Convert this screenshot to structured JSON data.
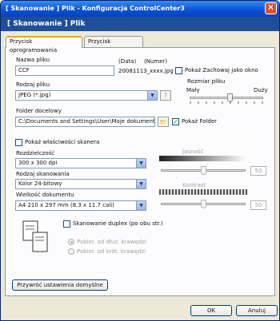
{
  "window": {
    "title": "[ Skanowanie ]  Plik - Konfiguracja ControlCenter3",
    "close_glyph": "×"
  },
  "header": {
    "text": "[ Skanowanie ]  Plik"
  },
  "tabs": [
    {
      "label": "Przycisk oprogramowania"
    },
    {
      "label": "Przycisk urządzenia"
    }
  ],
  "file_name": {
    "label": "Nazwa pliku",
    "value": "CCF",
    "date_label": "(Data)",
    "number_label": "(Numer)",
    "example": "20081113_xxxx.jpg"
  },
  "save_as_window": {
    "label": "Pokaż Zachowaj jako okno",
    "checked": false
  },
  "file_type": {
    "label": "Rodzaj pliku",
    "value": "JPEG (*.jpg)"
  },
  "file_size": {
    "label": "Rozmiar pliku",
    "small": "Mały",
    "large": "Duży",
    "level_fraction": 0.55
  },
  "dest_folder": {
    "label": "Folder docelowy",
    "value": "C:\\Documents and Settings\\User\\Moje dokumenty\\M",
    "show_folder_label": "Pokaż Folder",
    "show_folder_checked": true
  },
  "scanner_props": {
    "label": "Pokaż właściwości skanera",
    "checked": false
  },
  "resolution": {
    "label": "Rozdzielczość",
    "value": "300 x 300 dpi"
  },
  "scan_type": {
    "label": "Rodzaj skanowania",
    "value": "Kolor 24-bitowy"
  },
  "doc_size": {
    "label": "Wielkość dokumentu",
    "value": "A4 210 x 297 mm (8.3 x 11.7 cali)"
  },
  "brightness": {
    "label": "Jasność",
    "value": "50"
  },
  "contrast": {
    "label": "Kontrast",
    "value": "50"
  },
  "duplex": {
    "label": "Skanowanie duplex (po obu str.)",
    "checked": false,
    "options": [
      "Pobier. od dłuż. krawędzi",
      "Pobier. od krót. krawędzi"
    ]
  },
  "restore_button": {
    "label": "Przywróć ustawienia domyślne"
  },
  "footer": {
    "ok": "OK",
    "cancel": "Anuluj"
  },
  "icons": {
    "checkmark": "✓",
    "arrow_down": "▼",
    "help": "?",
    "folder": "📁"
  }
}
